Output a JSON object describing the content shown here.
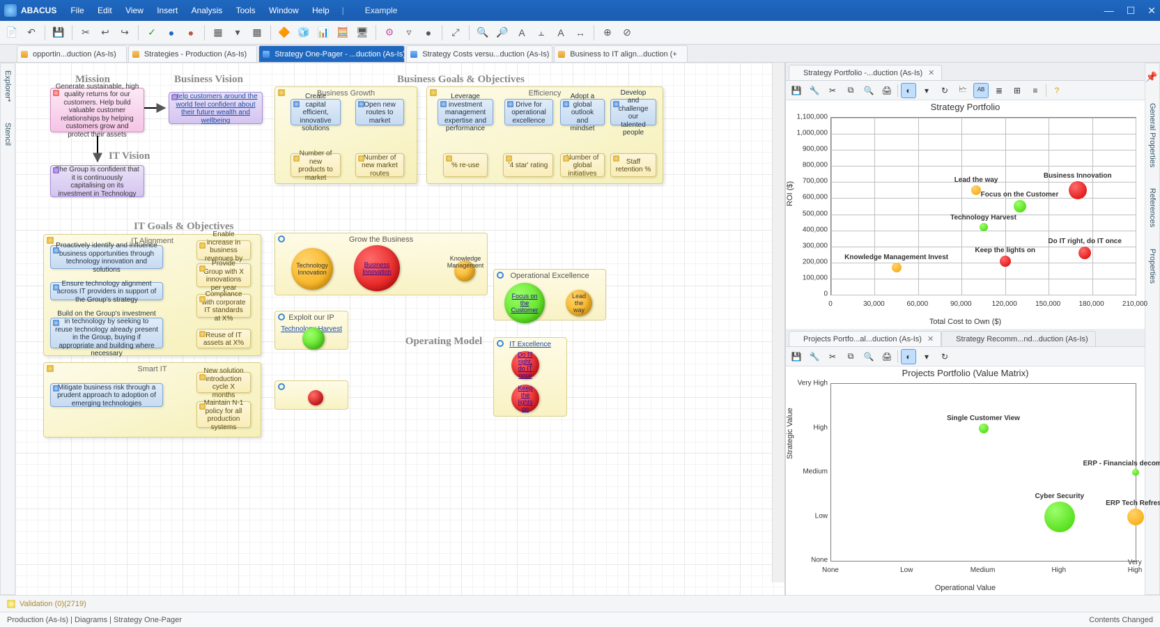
{
  "app": "ABACUS",
  "menus": [
    "File",
    "Edit",
    "View",
    "Insert",
    "Analysis",
    "Tools",
    "Window",
    "Help"
  ],
  "example": "Example",
  "winbtns": [
    "—",
    "☐",
    "✕"
  ],
  "doctabs": [
    {
      "label": "opportin...duction (As-Is)",
      "icon": "diagram"
    },
    {
      "label": "Strategies - Production (As-Is)",
      "icon": "diagram"
    },
    {
      "label": "Strategy One-Pager - ...duction (As-Is)",
      "icon": "chart",
      "active": true,
      "x": "✕"
    },
    {
      "label": "Strategy Costs versu...duction (As-Is)",
      "icon": "chart"
    },
    {
      "label": "Business to IT align...duction (+",
      "icon": "diagram"
    }
  ],
  "leftrail": [
    "Explorer*",
    "Stencil"
  ],
  "rightrail": [
    "General Properties",
    "References",
    "Properties"
  ],
  "headings": {
    "mission": "Mission",
    "bvision": "Business Vision",
    "bgoals": "Business Goals & Objectives",
    "itvision": "IT Vision",
    "itgoals": "IT Goals & Objectives",
    "opmodel": "Operating Model"
  },
  "mission_text": "Generate sustainable, high quality returns for our customers. Help build valuable customer relationships by helping customers grow and protect their assets",
  "bvision_text": "Help customers around the world feel confident about their future wealth and wellbeing",
  "itvision_text": "The Group is confident that it is continuously capitalising on its investment in Technology",
  "bgrowth": {
    "title": "Business Growth",
    "g1": "Create capital efficient, innovative solutions",
    "g2": "Open new routes to market",
    "m1": "Number of new products to market",
    "m2": "Number of new market routes"
  },
  "eff": {
    "title": "Efficiency",
    "g1": "Leverage investment management expertise and performance",
    "g2": "Drive for operational excellence",
    "g3": "Adopt a global outlook and mindset",
    "g4": "Develop and challenge our talented people",
    "m1": "% re-use",
    "m2": "'4 star' rating",
    "m3": "Number of global initiatives",
    "m4": "Staff retention %"
  },
  "italign": {
    "title": "IT Alignment",
    "b1": "Proactively identify and influence business opportunities through technology innovation and solutions",
    "b2": "Ensure technology alignment across IT providers in support of the Group's strategy",
    "b3": "Build on the Group's investment in technology by seeking to reuse technology already present in the Group, buying if appropriate and building where necessary",
    "c1": "Enable increase in business revenues by X%",
    "c2": "Provide Group with X innovations per year",
    "c3": "Compliance with corporate IT standards at X%",
    "c4": "Reuse of IT assets at X%"
  },
  "smartit": {
    "title": "Smart IT",
    "b1": "Mitigate business risk through a prudent approach to adoption of emerging technologies",
    "c1": "New solution introduction cycle X months",
    "c2": "Maintain N-1 policy for all production systems"
  },
  "panes": {
    "grow": "Grow the Business",
    "grow_b1": "Technology Innovation",
    "grow_b2": "Business Innovation",
    "grow_b3": "Knowledge Management",
    "exploit": "Exploit our IP",
    "exploit_b1": "Technology Harvest",
    "opex": "Operational Excellence",
    "opex_b1": "Focus on the Customer",
    "opex_b2": "Lead the way",
    "itex": "IT Excellence",
    "itex_b1": "Do IT right, do IT once",
    "itex_b2": "Keep the lights on"
  },
  "chart1": {
    "title": "Strategy Portfolio",
    "yaxis": "ROI ($)",
    "xaxis": "Total Cost to Own ($)",
    "yticks": [
      "0",
      "100,000",
      "200,000",
      "300,000",
      "400,000",
      "500,000",
      "600,000",
      "700,000",
      "800,000",
      "900,000",
      "1,000,000",
      "1,100,000"
    ],
    "xticks": [
      "0",
      "30,000",
      "60,000",
      "90,000",
      "120,000",
      "150,000",
      "180,000",
      "210,000"
    ]
  },
  "chart_data": {
    "type": "scatter",
    "title": "Strategy Portfolio",
    "xlabel": "Total Cost to Own ($)",
    "ylabel": "ROI ($)",
    "xlim": [
      0,
      210000
    ],
    "ylim": [
      0,
      1100000
    ],
    "points": [
      {
        "name": "Lead the way",
        "x": 100000,
        "y": 650000,
        "size": 14,
        "color": "orange"
      },
      {
        "name": "Focus on the Customer",
        "x": 130000,
        "y": 550000,
        "size": 18,
        "color": "green"
      },
      {
        "name": "Technology Harvest",
        "x": 105000,
        "y": 420000,
        "size": 12,
        "color": "green"
      },
      {
        "name": "Knowledge Management Invest",
        "x": 45000,
        "y": 170000,
        "size": 14,
        "color": "orange"
      },
      {
        "name": "Keep the lights on",
        "x": 120000,
        "y": 210000,
        "size": 16,
        "color": "red"
      },
      {
        "name": "Business Innovation",
        "x": 170000,
        "y": 650000,
        "size": 26,
        "color": "red"
      },
      {
        "name": "Do IT right, do IT once",
        "x": 175000,
        "y": 260000,
        "size": 18,
        "color": "red"
      }
    ]
  },
  "panel2tabs": [
    "Projects Portfo...al...duction (As-Is)",
    "Strategy Recomm...nd...duction (As-Is)"
  ],
  "chart2": {
    "title": "Projects Portfolio (Value Matrix)",
    "yaxis": "Strategic Value",
    "xaxis": "Operational Value",
    "cats": [
      "None",
      "Low",
      "Medium",
      "High",
      "Very High"
    ]
  },
  "chart2_data": {
    "type": "scatter",
    "title": "Projects Portfolio (Value Matrix)",
    "xlabel": "Operational Value",
    "ylabel": "Strategic Value",
    "categories": [
      "None",
      "Low",
      "Medium",
      "High",
      "Very High"
    ],
    "points": [
      {
        "name": "Single Customer View",
        "x": "Medium",
        "y": "High",
        "size": 14,
        "color": "green"
      },
      {
        "name": "ERP - Financials decommission",
        "x": "Very High",
        "y": "Medium",
        "size": 10,
        "color": "green"
      },
      {
        "name": "Cyber Security",
        "x": "High",
        "y": "Low",
        "size": 44,
        "color": "green"
      },
      {
        "name": "ERP Tech Refresh",
        "x": "Very High",
        "y": "Low",
        "size": 24,
        "color": "orange"
      }
    ]
  },
  "validation": "Validation (0)(2719)",
  "breadcrumb": "Production (As-Is) | Diagrams | Strategy One-Pager",
  "status_right": "Contents Changed",
  "paneltb": [
    "💾",
    "🔧",
    "✂",
    "⧉",
    "🔍",
    "🖨",
    "◐",
    "▾",
    "↻",
    "🗠",
    "ᴬᴮ",
    "≣",
    "⊞",
    "≡",
    "?"
  ],
  "toolbar_icons": [
    "📄",
    "↶",
    "💾",
    "✂",
    "↩",
    "↪",
    "✓",
    "●",
    "●",
    "▦",
    "▾",
    "▩",
    "🔶",
    "🧊",
    "📊",
    "🧮",
    "🖥",
    "⚙",
    "▿",
    "●",
    "⤢",
    "🔍",
    "🔎",
    "A",
    "⫠",
    "A",
    "↔",
    "⊕",
    "⊘"
  ]
}
